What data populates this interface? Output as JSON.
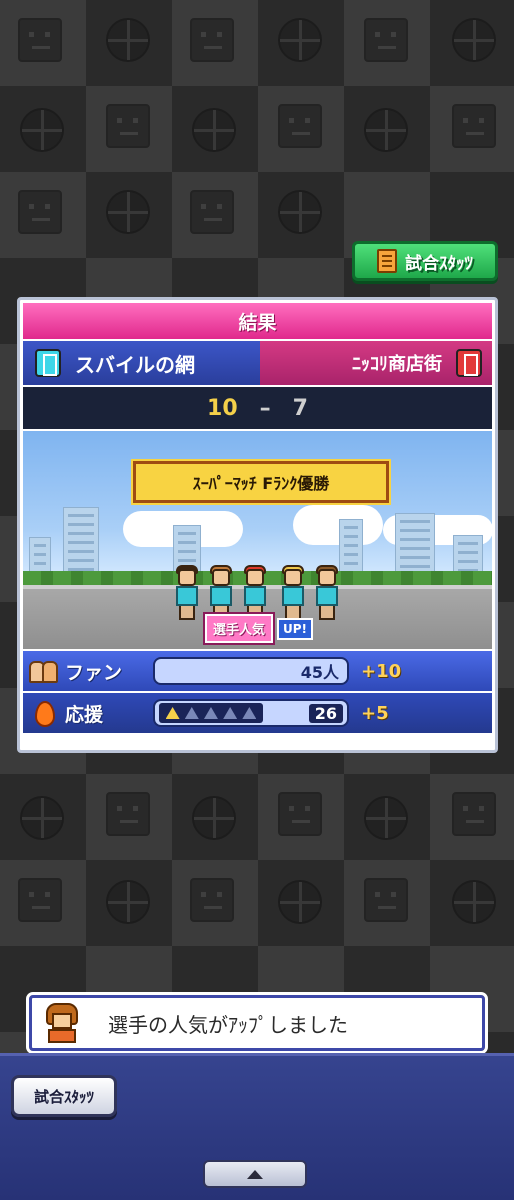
{
  "stats_button_label": "試合ｽﾀｯﾂ",
  "result_panel": {
    "title": "結果",
    "home_team": "スバイルの網",
    "away_team": "ﾆｯｺﾘ商店街",
    "home_score": "10",
    "separator": "–",
    "away_score": "7",
    "banner": "ｽｰﾊﾟｰﾏｯﾁ Fﾗﾝｸ優勝",
    "popularity_label": "選手人気",
    "popularity_up": "UP!",
    "fans": {
      "label": "ファン",
      "value": "45人",
      "delta": "+10"
    },
    "cheer": {
      "label": "応援",
      "stars_filled": 1,
      "stars_total": 5,
      "value": "26",
      "delta": "+5"
    }
  },
  "message": {
    "text": "選手の人気がｱｯﾌﾟしました"
  },
  "bottom_bar": {
    "stats_button_label": "試合ｽﾀｯﾂ"
  },
  "colors": {
    "panel_header": "#e0288c",
    "home_team": "#3c56c7",
    "away_team": "#d43a84",
    "stats_button": "#1fa84a"
  }
}
